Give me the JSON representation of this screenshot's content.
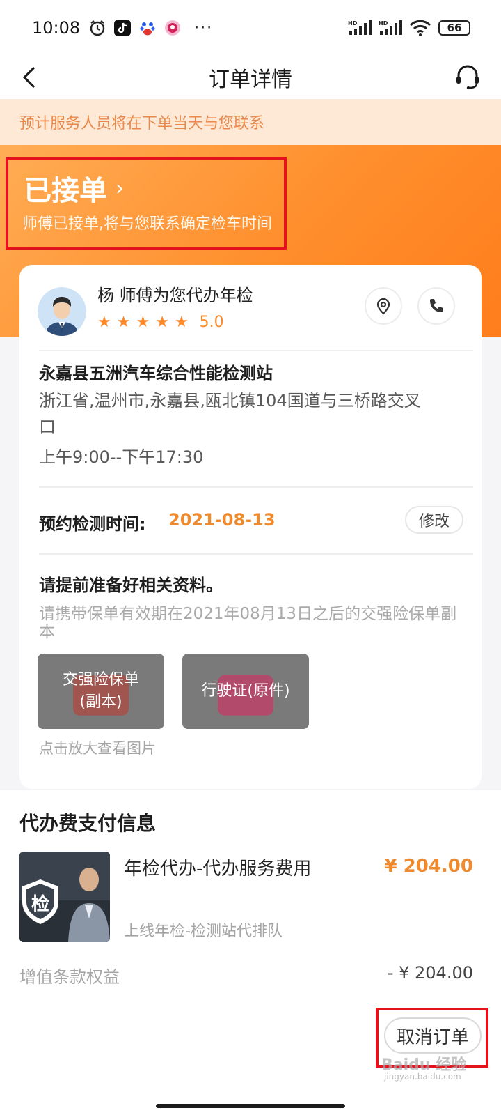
{
  "status_bar": {
    "time": "10:08",
    "more": "···",
    "battery": "66"
  },
  "nav": {
    "title": "订单详情"
  },
  "notice": {
    "text": "预计服务人员将在下单当天与您联系"
  },
  "order_status": {
    "title": "已接单",
    "chevron": "›",
    "description": "师傅已接单,将与您联系确定检车时间"
  },
  "master": {
    "line": "杨   师傅为您代办年检",
    "stars": [
      "★",
      "★",
      "★",
      "★",
      "★"
    ],
    "rating": "5.0"
  },
  "station": {
    "name": "永嘉县五洲汽车综合性能检测站",
    "address": "浙江省,温州市,永嘉县,瓯北镇104国道与三桥路交叉口",
    "hours": "上午9:00--下午17:30"
  },
  "appointment": {
    "label": "预约检测时间:",
    "date": "2021-08-13",
    "edit_label": "修改"
  },
  "preparation": {
    "title": "请提前准备好相关资料。",
    "description": "请携带保单有效期在2021年08月13日之后的交强险保单副本",
    "documents": [
      {
        "label": "交强险保单(副本)"
      },
      {
        "label": "行驶证(原件)"
      }
    ],
    "hint": "点击放大查看图片"
  },
  "payment": {
    "title": "代办费支付信息",
    "service_name": "年检代办-代办服务费用",
    "service_price": "¥ 204.00",
    "service_sub": "上线年检-检测站代排队",
    "thumb_badge": "检",
    "benefit_label": "增值条款权益",
    "benefit_value": "- ¥ 204.00",
    "cancel_label": "取消订单"
  },
  "watermark": {
    "text": "Baidu 经验",
    "sub": "jingyan.baidu.com"
  },
  "colors": {
    "accent": "#f08a2e",
    "highlight_box": "#e4121c",
    "notice_bg": "#fde9d6"
  }
}
